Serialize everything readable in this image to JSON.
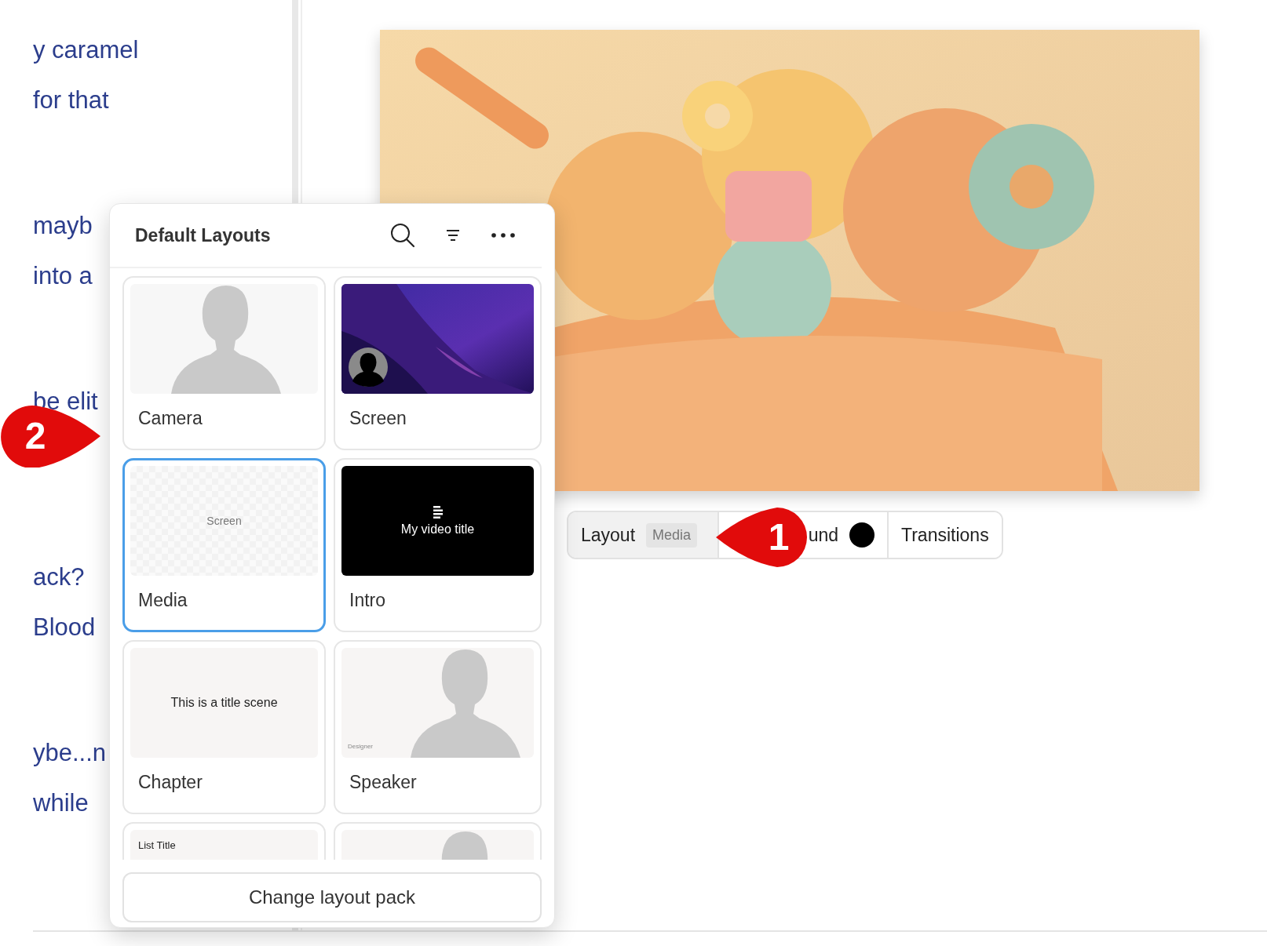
{
  "document": {
    "paragraphs": [
      {
        "lines": [
          "y caramel",
          "for that"
        ]
      },
      {
        "lines": [
          "mayb",
          "into a"
        ]
      },
      {
        "lines": [
          "be elit"
        ]
      },
      {
        "lines": [
          "ack?",
          "Blood"
        ]
      },
      {
        "lines": [
          "ybe...n",
          "while"
        ]
      }
    ]
  },
  "toolbar": {
    "segments": [
      {
        "kind": "layout",
        "label": "Layout",
        "badge": "Media"
      },
      {
        "kind": "background",
        "label": "und",
        "color": "#000000"
      },
      {
        "kind": "plain",
        "label": "Transitions"
      }
    ]
  },
  "layouts_panel": {
    "title": "Default Layouts",
    "tiles": [
      {
        "kind": "camera",
        "label": "Camera",
        "selected": false
      },
      {
        "kind": "screen",
        "label": "Screen",
        "selected": false
      },
      {
        "kind": "media",
        "label": "Media",
        "thumb_text": "Screen",
        "selected": true
      },
      {
        "kind": "intro",
        "label": "Intro",
        "thumb_text": "My video title",
        "selected": false
      },
      {
        "kind": "chapter",
        "label": "Chapter",
        "thumb_text": "This is a title scene",
        "selected": false
      },
      {
        "kind": "speaker",
        "label": "Speaker",
        "thumb_text": "Designer",
        "selected": false
      },
      {
        "kind": "list",
        "thumb_text": "List Title",
        "selected": false
      },
      {
        "kind": "speaker",
        "selected": false
      }
    ],
    "button": "Change layout pack"
  },
  "markers": [
    {
      "number": "1"
    },
    {
      "number": "2"
    }
  ]
}
